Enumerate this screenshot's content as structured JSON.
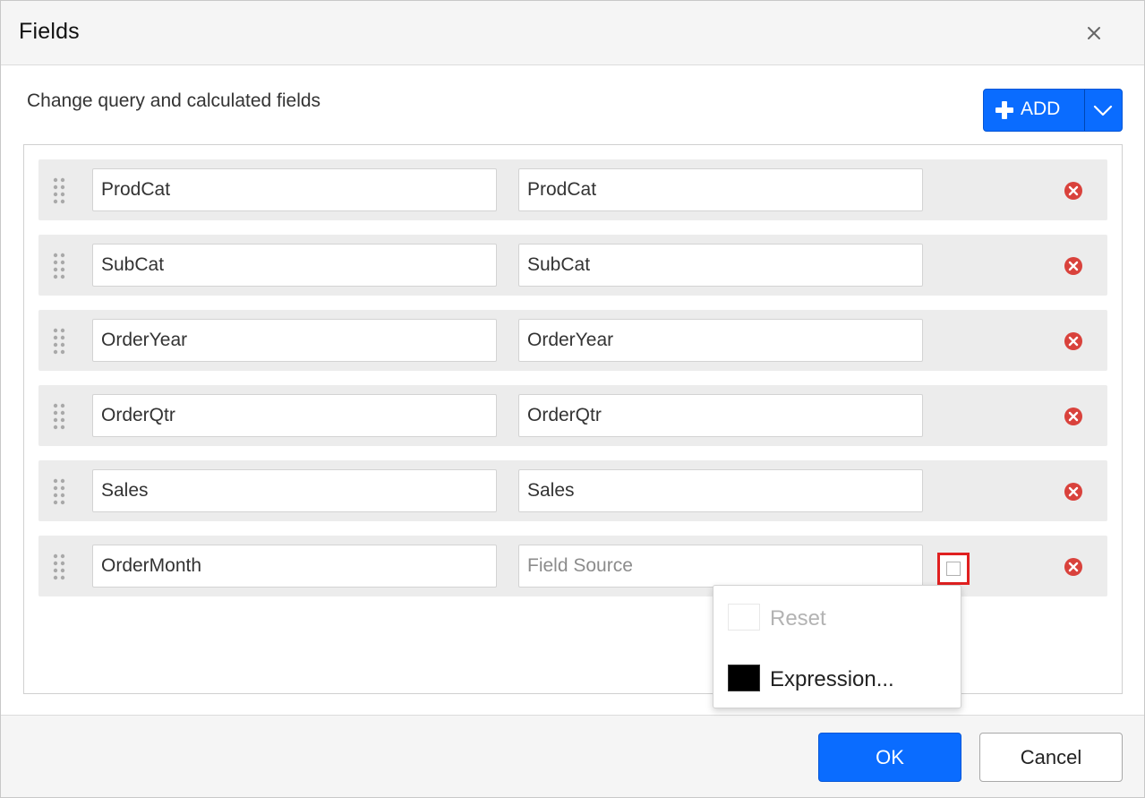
{
  "dialog": {
    "title": "Fields",
    "subtitle": "Change query and calculated fields",
    "add_label": "ADD",
    "ok_label": "OK",
    "cancel_label": "Cancel"
  },
  "fields": [
    {
      "name": "ProdCat",
      "source": "ProdCat"
    },
    {
      "name": "SubCat",
      "source": "SubCat"
    },
    {
      "name": "OrderYear",
      "source": "OrderYear"
    },
    {
      "name": "OrderQtr",
      "source": "OrderQtr"
    },
    {
      "name": "Sales",
      "source": "Sales"
    },
    {
      "name": "OrderMonth",
      "source": "",
      "source_placeholder": "Field Source"
    }
  ],
  "menu": {
    "items": [
      {
        "label": "Reset",
        "enabled": false
      },
      {
        "label": "Expression...",
        "enabled": true
      }
    ]
  },
  "colors": {
    "accent": "#0a6cff",
    "remove": "#d9423c",
    "highlight": "#e02020"
  },
  "icons": {
    "close": "close-icon",
    "add": "plus-icon",
    "dropdown": "chevron-down-icon",
    "drag": "drag-handle-icon",
    "remove": "remove-circle-icon"
  }
}
